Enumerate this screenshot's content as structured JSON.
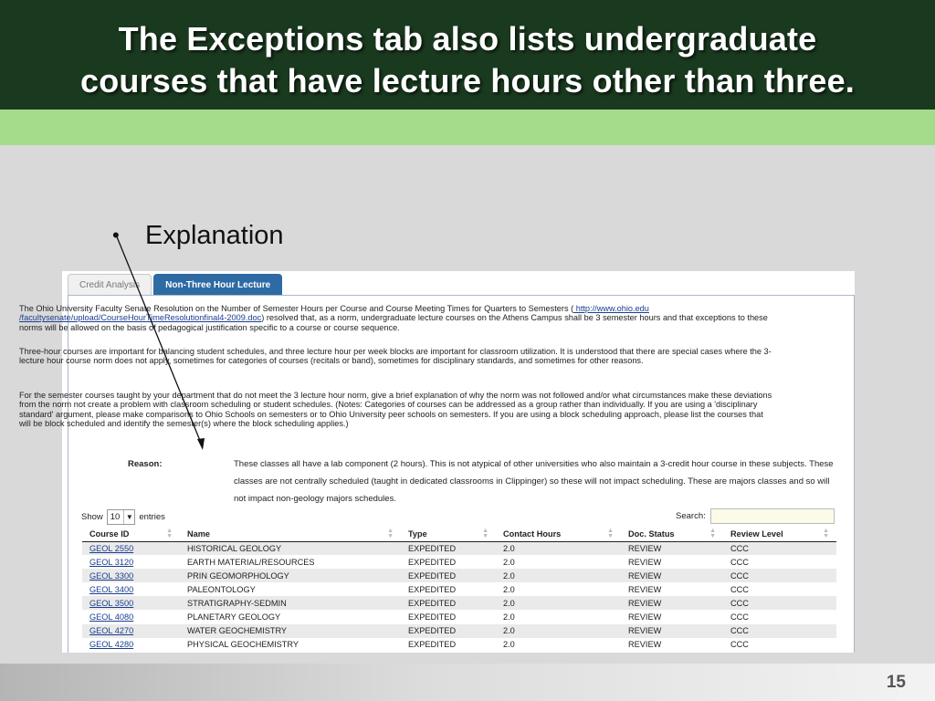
{
  "slide": {
    "title_line1": "The Exceptions tab also lists undergraduate",
    "title_line2": "courses that have lecture hours other than three.",
    "bullet": "Explanation",
    "page_number": "15"
  },
  "tabs": [
    {
      "label": "Credit Analysis",
      "active": false
    },
    {
      "label": "Non-Three Hour Lecture",
      "active": true
    }
  ],
  "content": {
    "para1_pre": "The Ohio University Faculty Senate Resolution on the Number of Semester Hours per Course and Course Meeting Times for Quarters to Semesters (",
    "para1_link": " http://www.ohio.edu /facultysenate/upload/CourseHourTimeResolutionfinal4-2009.doc",
    "para1_post": ") resolved that, as a norm, undergraduate lecture courses on the Athens Campus shall be 3 semester hours and that exceptions to these norms will be allowed on the basis of pedagogical justification specific to a course or course sequence.",
    "para2": "Three-hour courses are important for balancing student schedules, and three lecture hour per week blocks are important for classroom utilization. It is understood that there are special cases where the 3-lecture hour course norm does not apply, sometimes for categories of courses (recitals or band), sometimes for disciplinary standards, and sometimes for other reasons.",
    "para3": "For the semester courses taught by your department that do not meet the 3 lecture hour norm, give a brief explanation of why the norm was not followed and/or what circumstances make these deviations from the norm not create a problem with classroom scheduling or student schedules. (Notes: Categories of courses can be addressed as a group rather than individually. If you are using a 'disciplinary standard' argument, please make comparisons to Ohio Schools on semesters or to Ohio University peer schools on semesters. If you are using a block scheduling approach, please list the courses that will be block scheduled and identify the semester(s) where the block scheduling applies.)",
    "reason_label": "Reason:",
    "reason_text": "These classes all have a lab component (2 hours). This is not atypical of other universities who also maintain a 3-credit hour course in these subjects. These classes are not centrally scheduled (taught in dedicated classrooms in Clippinger) so these will not impact scheduling. These are majors classes and so will not impact non-geology majors schedules."
  },
  "table_controls": {
    "show_label": "Show",
    "entries_value": "10",
    "entries_label": "entries",
    "search_label": "Search:",
    "search_value": ""
  },
  "table": {
    "headers": [
      "Course ID",
      "Name",
      "Type",
      "Contact Hours",
      "Doc. Status",
      "Review Level"
    ],
    "rows": [
      [
        "GEOL 2550",
        "HISTORICAL GEOLOGY",
        "EXPEDITED",
        "2.0",
        "REVIEW",
        "CCC"
      ],
      [
        "GEOL 3120",
        "EARTH MATERIAL/RESOURCES",
        "EXPEDITED",
        "2.0",
        "REVIEW",
        "CCC"
      ],
      [
        "GEOL 3300",
        "PRIN GEOMORPHOLOGY",
        "EXPEDITED",
        "2.0",
        "REVIEW",
        "CCC"
      ],
      [
        "GEOL 3400",
        "PALEONTOLOGY",
        "EXPEDITED",
        "2.0",
        "REVIEW",
        "CCC"
      ],
      [
        "GEOL 3500",
        "STRATIGRAPHY-SEDMIN",
        "EXPEDITED",
        "2.0",
        "REVIEW",
        "CCC"
      ],
      [
        "GEOL 4080",
        "PLANETARY GEOLOGY",
        "EXPEDITED",
        "2.0",
        "REVIEW",
        "CCC"
      ],
      [
        "GEOL 4270",
        "WATER GEOCHEMISTRY",
        "EXPEDITED",
        "2.0",
        "REVIEW",
        "CCC"
      ],
      [
        "GEOL 4280",
        "PHYSICAL GEOCHEMISTRY",
        "EXPEDITED",
        "2.0",
        "REVIEW",
        "CCC"
      ]
    ]
  },
  "colors": {
    "header_bg": "#1a3a1f",
    "accent_band": "#a4dc8c",
    "active_tab": "#2e6aa3",
    "link": "#1a3d8f"
  }
}
